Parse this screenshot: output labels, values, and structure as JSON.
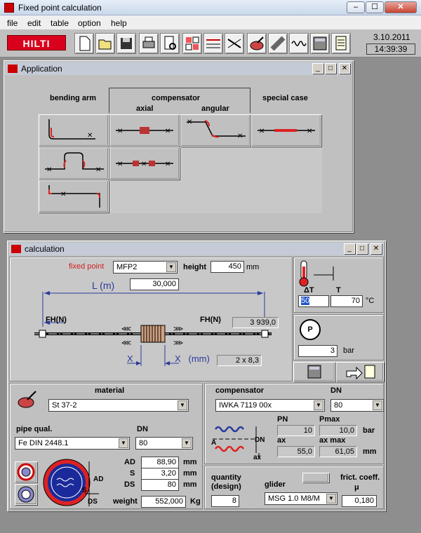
{
  "app": {
    "title": "Fixed point calculation",
    "date": "3.10.2011",
    "time": "14:39:39",
    "logo": "HILTI",
    "window_controls": {
      "minimize": "–",
      "maximize": "☐",
      "close": "✕"
    }
  },
  "menu": [
    "file",
    "edit",
    "table",
    "option",
    "help"
  ],
  "toolbar": {
    "icons": [
      "new-file-icon",
      "open-folder-icon",
      "save-disk-icon",
      "print-icon",
      "print-preview-icon",
      "compare-icon",
      "pipe-dimension-icon",
      "spanner-icon",
      "material-icon",
      "pipe-icon",
      "compensator-icon",
      "calculator-icon",
      "notes-icon"
    ]
  },
  "app_window": {
    "title": "Application",
    "headers": {
      "bending_arm": "bending arm",
      "compensator": "compensator",
      "axial": "axial",
      "angular": "angular",
      "special_case": "special case"
    },
    "controls": {
      "minimize": "_",
      "maximize": "□",
      "close": "✕"
    }
  },
  "calc_window": {
    "title": "calculation",
    "controls": {
      "minimize": "_",
      "maximize": "□",
      "close": "✕"
    },
    "fixed_point": {
      "label": "fixed point",
      "value": "MFP2"
    },
    "height": {
      "label": "height",
      "value": "450",
      "unit": "mm"
    },
    "length": {
      "label": "L  (m)",
      "value": "30,000"
    },
    "force_left": "FH(N)",
    "force_right": "FH(N)",
    "force_value": "3 939,0",
    "x_label": "X",
    "x_unit": "X   (mm)",
    "x_value": "2 x 8,3",
    "delta_t": {
      "label": "ΔT",
      "value": "50"
    },
    "t": {
      "label": "T",
      "value": "70"
    },
    "temp_unit": "°C",
    "pressure": {
      "value": "3",
      "unit": "bar"
    },
    "material": {
      "label": "material",
      "value": "St 37-2"
    },
    "pipe_qual": {
      "label": "pipe qual.",
      "value": "Fe DIN 2448.1"
    },
    "dn_pipe": {
      "label": "DN",
      "value": "80"
    },
    "ad": {
      "label": "AD",
      "value": "88,90",
      "unit": "mm"
    },
    "s": {
      "label": "S",
      "value": "3,20",
      "unit": "mm"
    },
    "ds": {
      "label": "DS",
      "value": "80",
      "unit": "mm"
    },
    "weight": {
      "label": "weight",
      "value": "552,000",
      "unit": "Kg"
    },
    "compensator": {
      "label": "compensator",
      "value": "IWKA 7119 00x"
    },
    "dn_comp": {
      "label": "DN",
      "value": "80"
    },
    "pn": {
      "label": "PN",
      "value": "10"
    },
    "pmax": {
      "label": "Pmax",
      "value": "10,0",
      "unit": "bar"
    },
    "ax": {
      "label": "ax",
      "value": "55,0"
    },
    "ax_max": {
      "label": "ax max",
      "value": "61,05",
      "unit": "mm"
    },
    "quantity": {
      "label": "quantity\n(design)",
      "value": "8"
    },
    "glider": {
      "label": "glider",
      "value": "MSG 1.0 M8/M"
    },
    "friction": {
      "label": "frict. coeff.",
      "mu": "μ",
      "value": "0,180"
    },
    "diagram_labels": {
      "A": "A",
      "DN": "DN",
      "ax": "ax",
      "AD": "AD",
      "S": "S",
      "DS": "DS",
      "P": "P"
    }
  }
}
